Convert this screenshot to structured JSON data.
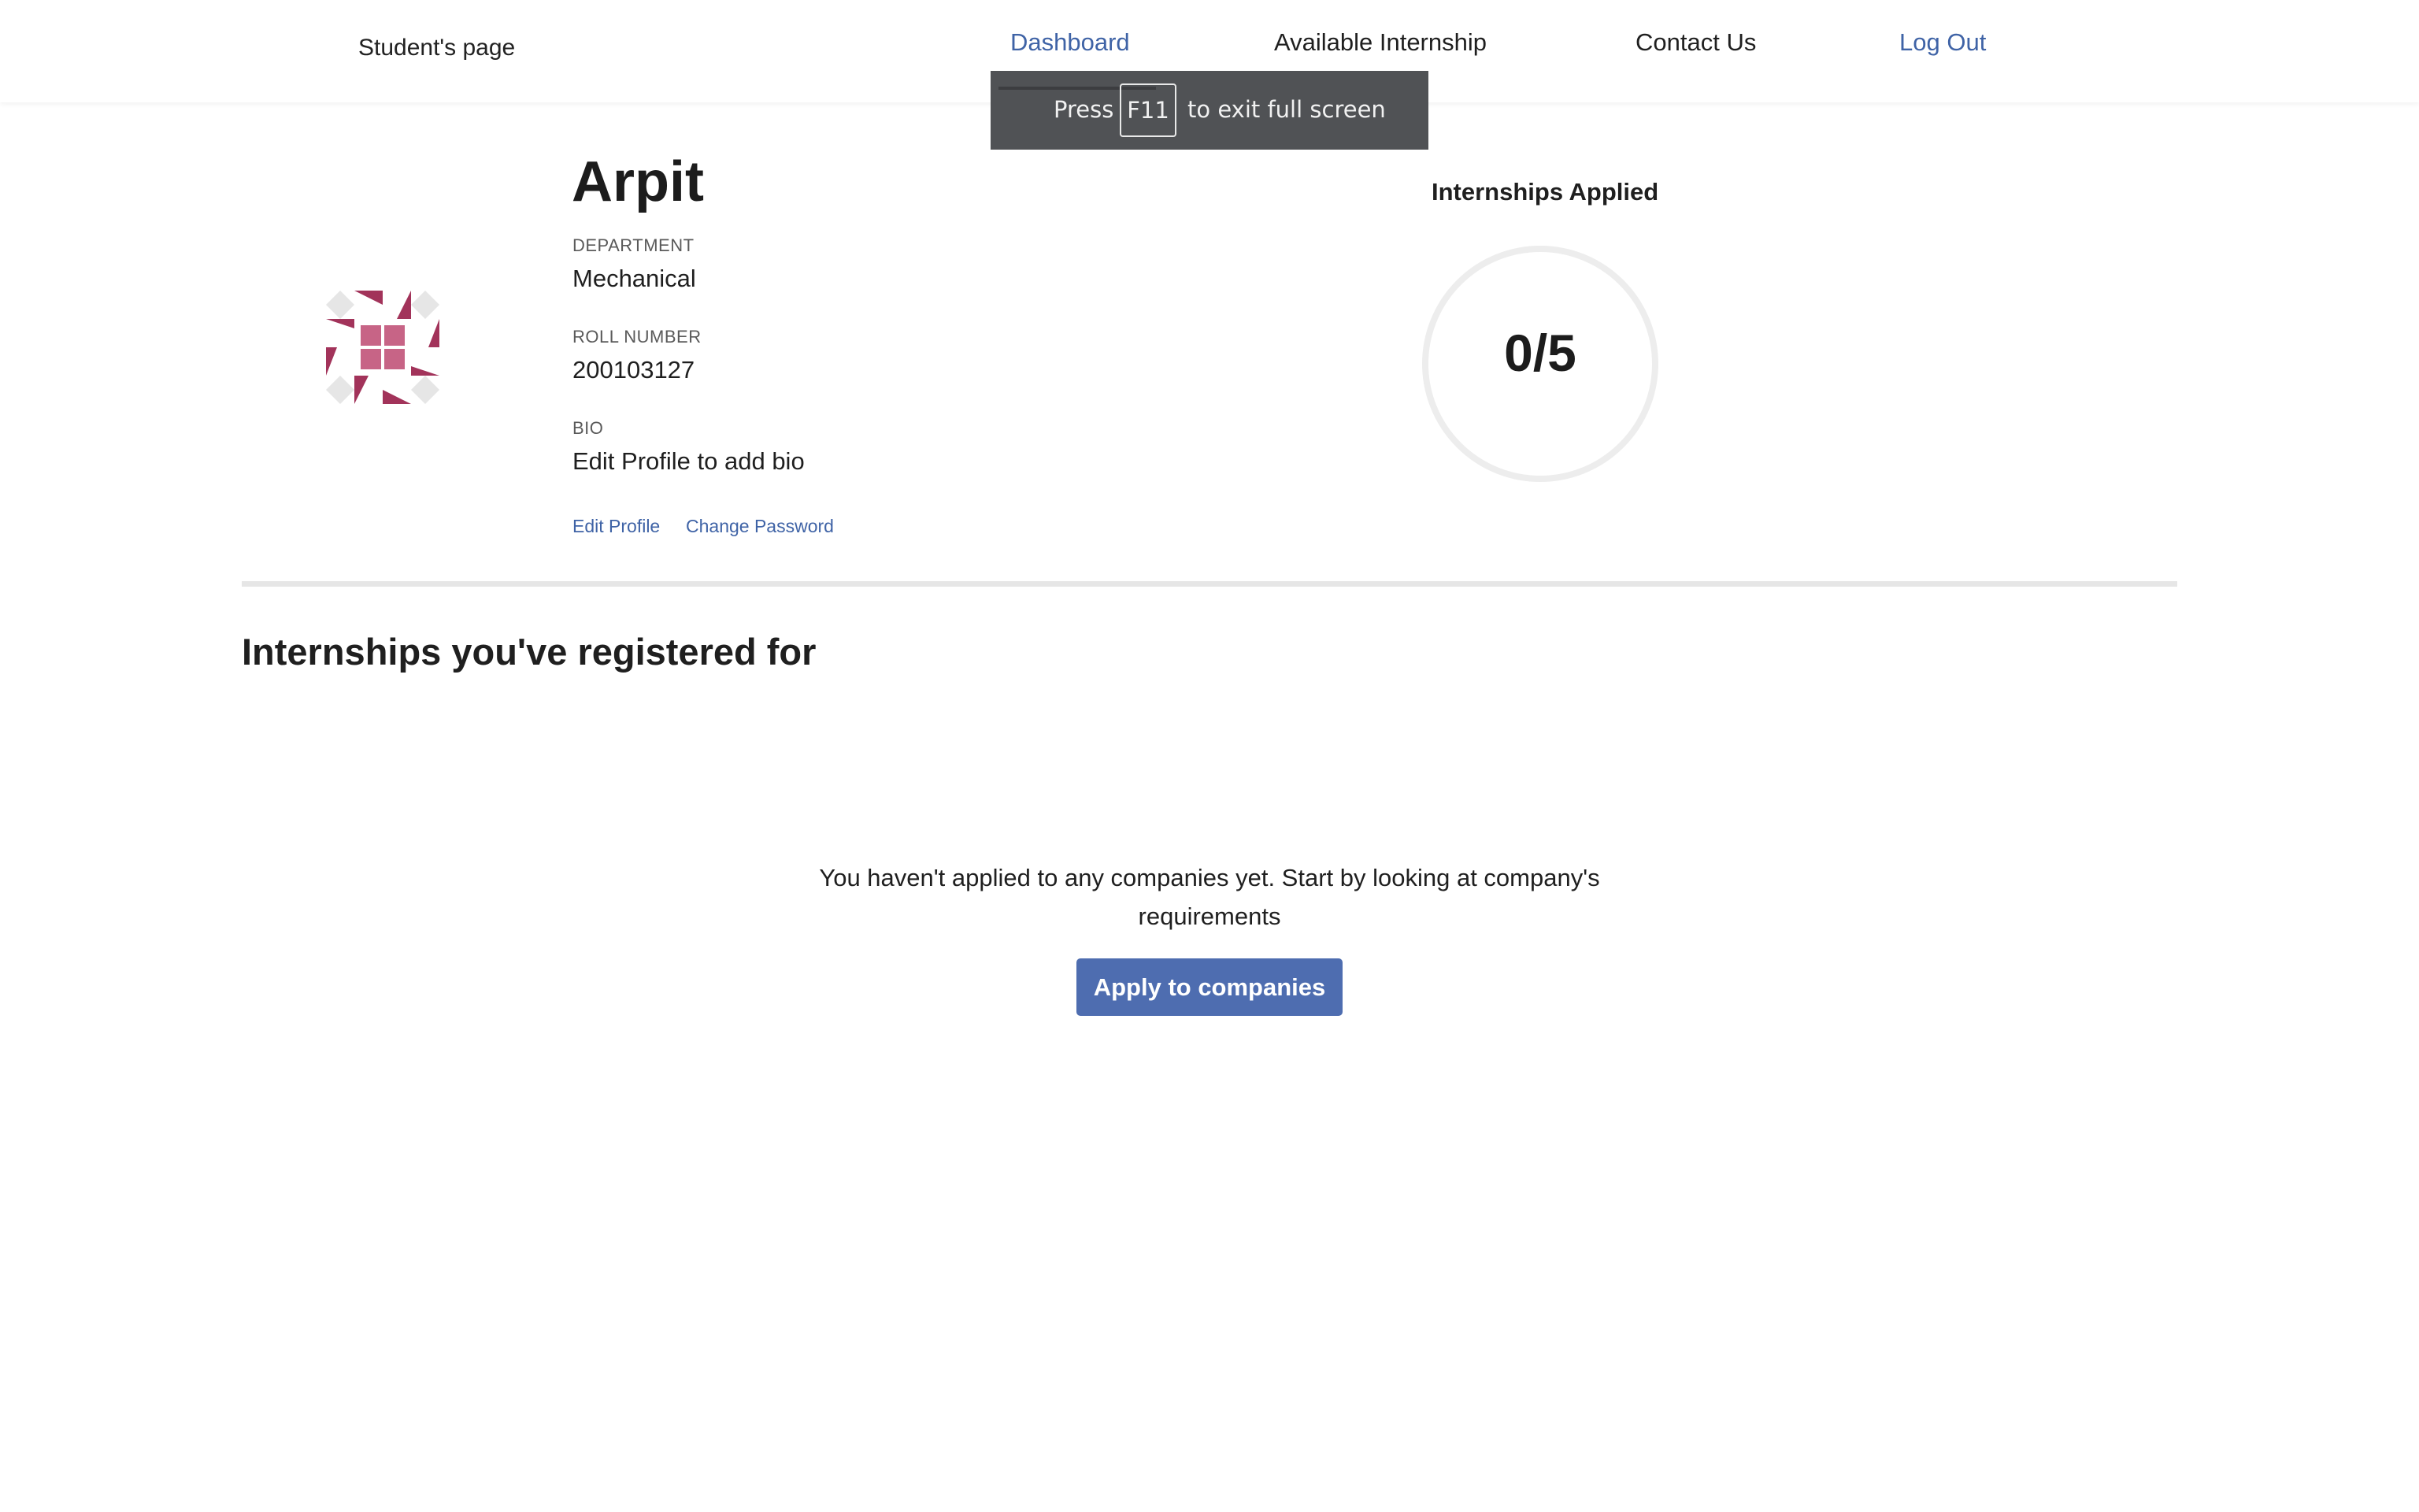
{
  "navbar": {
    "brand": "Student's page",
    "links": {
      "dashboard": "Dashboard",
      "available_internship": "Available Internship",
      "contact_us": "Contact Us",
      "log_out": "Log Out"
    }
  },
  "fullscreen_toast": {
    "press": "Press",
    "key": "F11",
    "rest": "to exit full screen"
  },
  "profile": {
    "name": "Arpit",
    "department_label": "DEPARTMENT",
    "department": "Mechanical",
    "roll_label": "ROLL NUMBER",
    "roll_number": "200103127",
    "bio_label": "BIO",
    "bio": "Edit Profile to add bio",
    "edit_profile": "Edit Profile",
    "change_password": "Change Password",
    "avatar_icon": "identicon-avatar"
  },
  "applied": {
    "title": "Internships Applied",
    "value": "0/5"
  },
  "internships": {
    "section_title": "Internships you've registered for",
    "empty_message": "You haven't applied to any companies yet. Start by looking at company's requirements",
    "apply_button": "Apply to companies"
  },
  "colors": {
    "accent": "#3f63a6",
    "button": "#4e6db0",
    "identicon": "#a2335a"
  }
}
